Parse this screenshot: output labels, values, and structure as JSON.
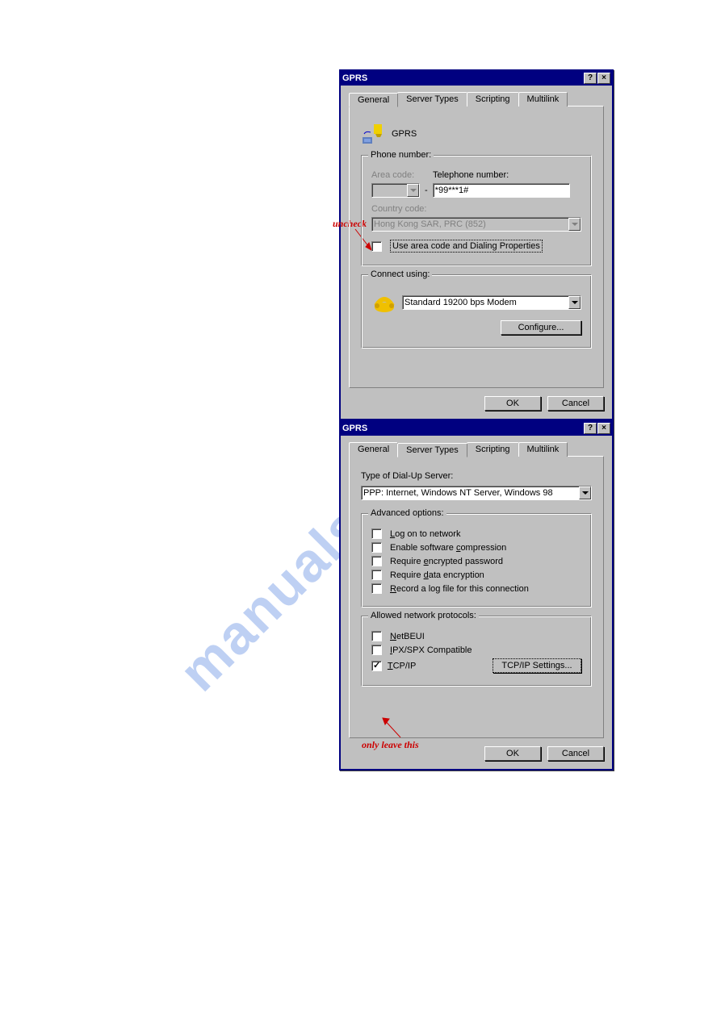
{
  "watermark": "manualshive.com",
  "dialog1": {
    "title": "GPRS",
    "tabs": [
      "General",
      "Server Types",
      "Scripting",
      "Multilink"
    ],
    "activeTab": 0,
    "connName": "GPRS",
    "group_phone_label": "Phone number:",
    "areacode_label": "Area code:",
    "telnum_label": "Telephone number:",
    "telnum_value": "*99***1#",
    "separator_dash": "-",
    "countrycode_label": "Country code:",
    "countrycode_value": "Hong Kong SAR, PRC (852)",
    "useareacode_label": "Use area code and Dialing Properties",
    "group_connect_label": "Connect using:",
    "modem_value": "Standard 19200 bps Modem",
    "configure_label": "Configure...",
    "ok_label": "OK",
    "cancel_label": "Cancel",
    "help_icon": "?",
    "close_icon": "×"
  },
  "dialog2": {
    "title": "GPRS",
    "tabs": [
      "General",
      "Server Types",
      "Scripting",
      "Multilink"
    ],
    "activeTab": 1,
    "typeofserver_label": "Type of Dial-Up Server:",
    "typeofserver_value": "PPP: Internet, Windows NT Server, Windows 98",
    "group_adv_label": "Advanced options:",
    "chk_logon": "Log on to network",
    "chk_comp": "Enable software compression",
    "chk_encpw": "Require encrypted password",
    "chk_encdata": "Require data encryption",
    "chk_logfile": "Record a log file for this connection",
    "group_proto_label": "Allowed network protocols:",
    "chk_netbeui": "NetBEUI",
    "chk_ipx": "IPX/SPX Compatible",
    "chk_tcpip": "TCP/IP",
    "tcpip_settings_label": "TCP/IP Settings...",
    "ok_label": "OK",
    "cancel_label": "Cancel",
    "help_icon": "?",
    "close_icon": "×"
  },
  "annot1": "uncheck",
  "annot2": "only leave this"
}
